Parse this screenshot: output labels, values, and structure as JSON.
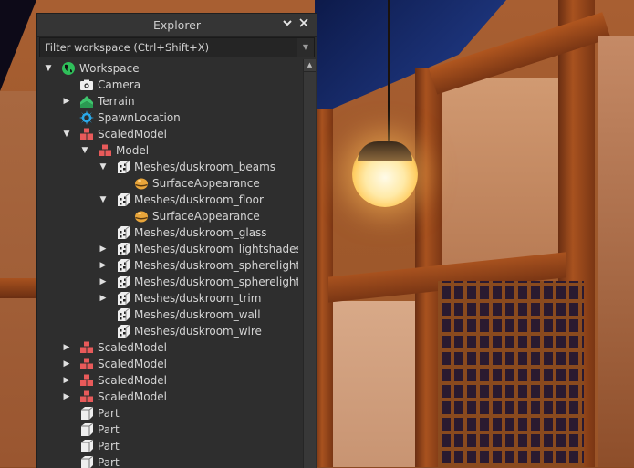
{
  "explorer": {
    "title": "Explorer",
    "filter_placeholder": "Filter workspace (Ctrl+Shift+X)",
    "filter_value": "",
    "controls": {
      "collapse_icon": "chevron-down-icon",
      "close_icon": "close-icon"
    }
  },
  "tree": [
    {
      "label": "Workspace",
      "depth": 0,
      "expander": "expanded",
      "icon": "workspace-globe-icon"
    },
    {
      "label": "Camera",
      "depth": 1,
      "expander": "none",
      "icon": "camera-icon"
    },
    {
      "label": "Terrain",
      "depth": 1,
      "expander": "collapsed",
      "icon": "terrain-icon"
    },
    {
      "label": "SpawnLocation",
      "depth": 1,
      "expander": "none",
      "icon": "spawn-location-icon"
    },
    {
      "label": "ScaledModel",
      "depth": 1,
      "expander": "expanded",
      "icon": "model-icon"
    },
    {
      "label": "Model",
      "depth": 2,
      "expander": "expanded",
      "icon": "model-icon"
    },
    {
      "label": "Meshes/duskroom_beams",
      "depth": 3,
      "expander": "expanded",
      "icon": "meshpart-icon"
    },
    {
      "label": "SurfaceAppearance",
      "depth": 4,
      "expander": "none",
      "icon": "surface-appearance-icon"
    },
    {
      "label": "Meshes/duskroom_floor",
      "depth": 3,
      "expander": "expanded",
      "icon": "meshpart-icon"
    },
    {
      "label": "SurfaceAppearance",
      "depth": 4,
      "expander": "none",
      "icon": "surface-appearance-icon"
    },
    {
      "label": "Meshes/duskroom_glass",
      "depth": 3,
      "expander": "none",
      "icon": "meshpart-icon"
    },
    {
      "label": "Meshes/duskroom_lightshades",
      "depth": 3,
      "expander": "collapsed",
      "icon": "meshpart-icon"
    },
    {
      "label": "Meshes/duskroom_spherelights",
      "depth": 3,
      "expander": "collapsed",
      "icon": "meshpart-icon"
    },
    {
      "label": "Meshes/duskroom_spherelights",
      "depth": 3,
      "expander": "collapsed",
      "icon": "meshpart-icon"
    },
    {
      "label": "Meshes/duskroom_trim",
      "depth": 3,
      "expander": "collapsed",
      "icon": "meshpart-icon"
    },
    {
      "label": "Meshes/duskroom_wall",
      "depth": 3,
      "expander": "none",
      "icon": "meshpart-icon"
    },
    {
      "label": "Meshes/duskroom_wire",
      "depth": 3,
      "expander": "none",
      "icon": "meshpart-icon"
    },
    {
      "label": "ScaledModel",
      "depth": 1,
      "expander": "collapsed",
      "icon": "model-icon"
    },
    {
      "label": "ScaledModel",
      "depth": 1,
      "expander": "collapsed",
      "icon": "model-icon"
    },
    {
      "label": "ScaledModel",
      "depth": 1,
      "expander": "collapsed",
      "icon": "model-icon"
    },
    {
      "label": "ScaledModel",
      "depth": 1,
      "expander": "collapsed",
      "icon": "model-icon"
    },
    {
      "label": "Part",
      "depth": 1,
      "expander": "none",
      "icon": "part-icon"
    },
    {
      "label": "Part",
      "depth": 1,
      "expander": "none",
      "icon": "part-icon"
    },
    {
      "label": "Part",
      "depth": 1,
      "expander": "none",
      "icon": "part-icon"
    },
    {
      "label": "Part",
      "depth": 1,
      "expander": "none",
      "icon": "part-icon"
    }
  ],
  "colors": {
    "panel_bg": "#2e2e2e",
    "text": "#d4d4d4",
    "workspace_icon": "#2fbf5a",
    "terrain_icon": "#3ec46d",
    "spawn_icon": "#2aa8e8",
    "model_icon": "#e85a5a",
    "surface_icon": "#e8a53a"
  }
}
